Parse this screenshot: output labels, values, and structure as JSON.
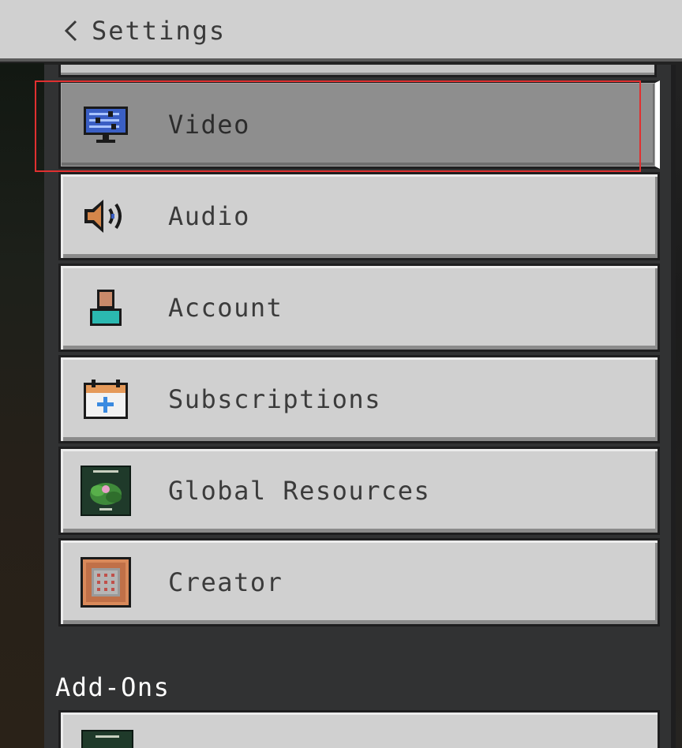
{
  "header": {
    "title": "Settings",
    "back_icon": "chevron-left-icon"
  },
  "menu": {
    "items": [
      {
        "label": "Video",
        "icon": "monitor-sliders-icon",
        "selected": true
      },
      {
        "label": "Audio",
        "icon": "speaker-icon",
        "selected": false
      },
      {
        "label": "Account",
        "icon": "account-person-icon",
        "selected": false
      },
      {
        "label": "Subscriptions",
        "icon": "calendar-plus-icon",
        "selected": false
      },
      {
        "label": "Global Resources",
        "icon": "resource-pack-thumbnail-icon",
        "selected": false
      },
      {
        "label": "Creator",
        "icon": "command-block-icon",
        "selected": false
      }
    ]
  },
  "addons": {
    "heading": "Add-Ons"
  },
  "colors": {
    "header_bg": "#d0d0d0",
    "button_bg": "#d0d0d0",
    "selected_bg": "#8e8e8e",
    "panel_bg": "#313233",
    "highlight": "#e03030",
    "heading_text": "#ffffff"
  }
}
